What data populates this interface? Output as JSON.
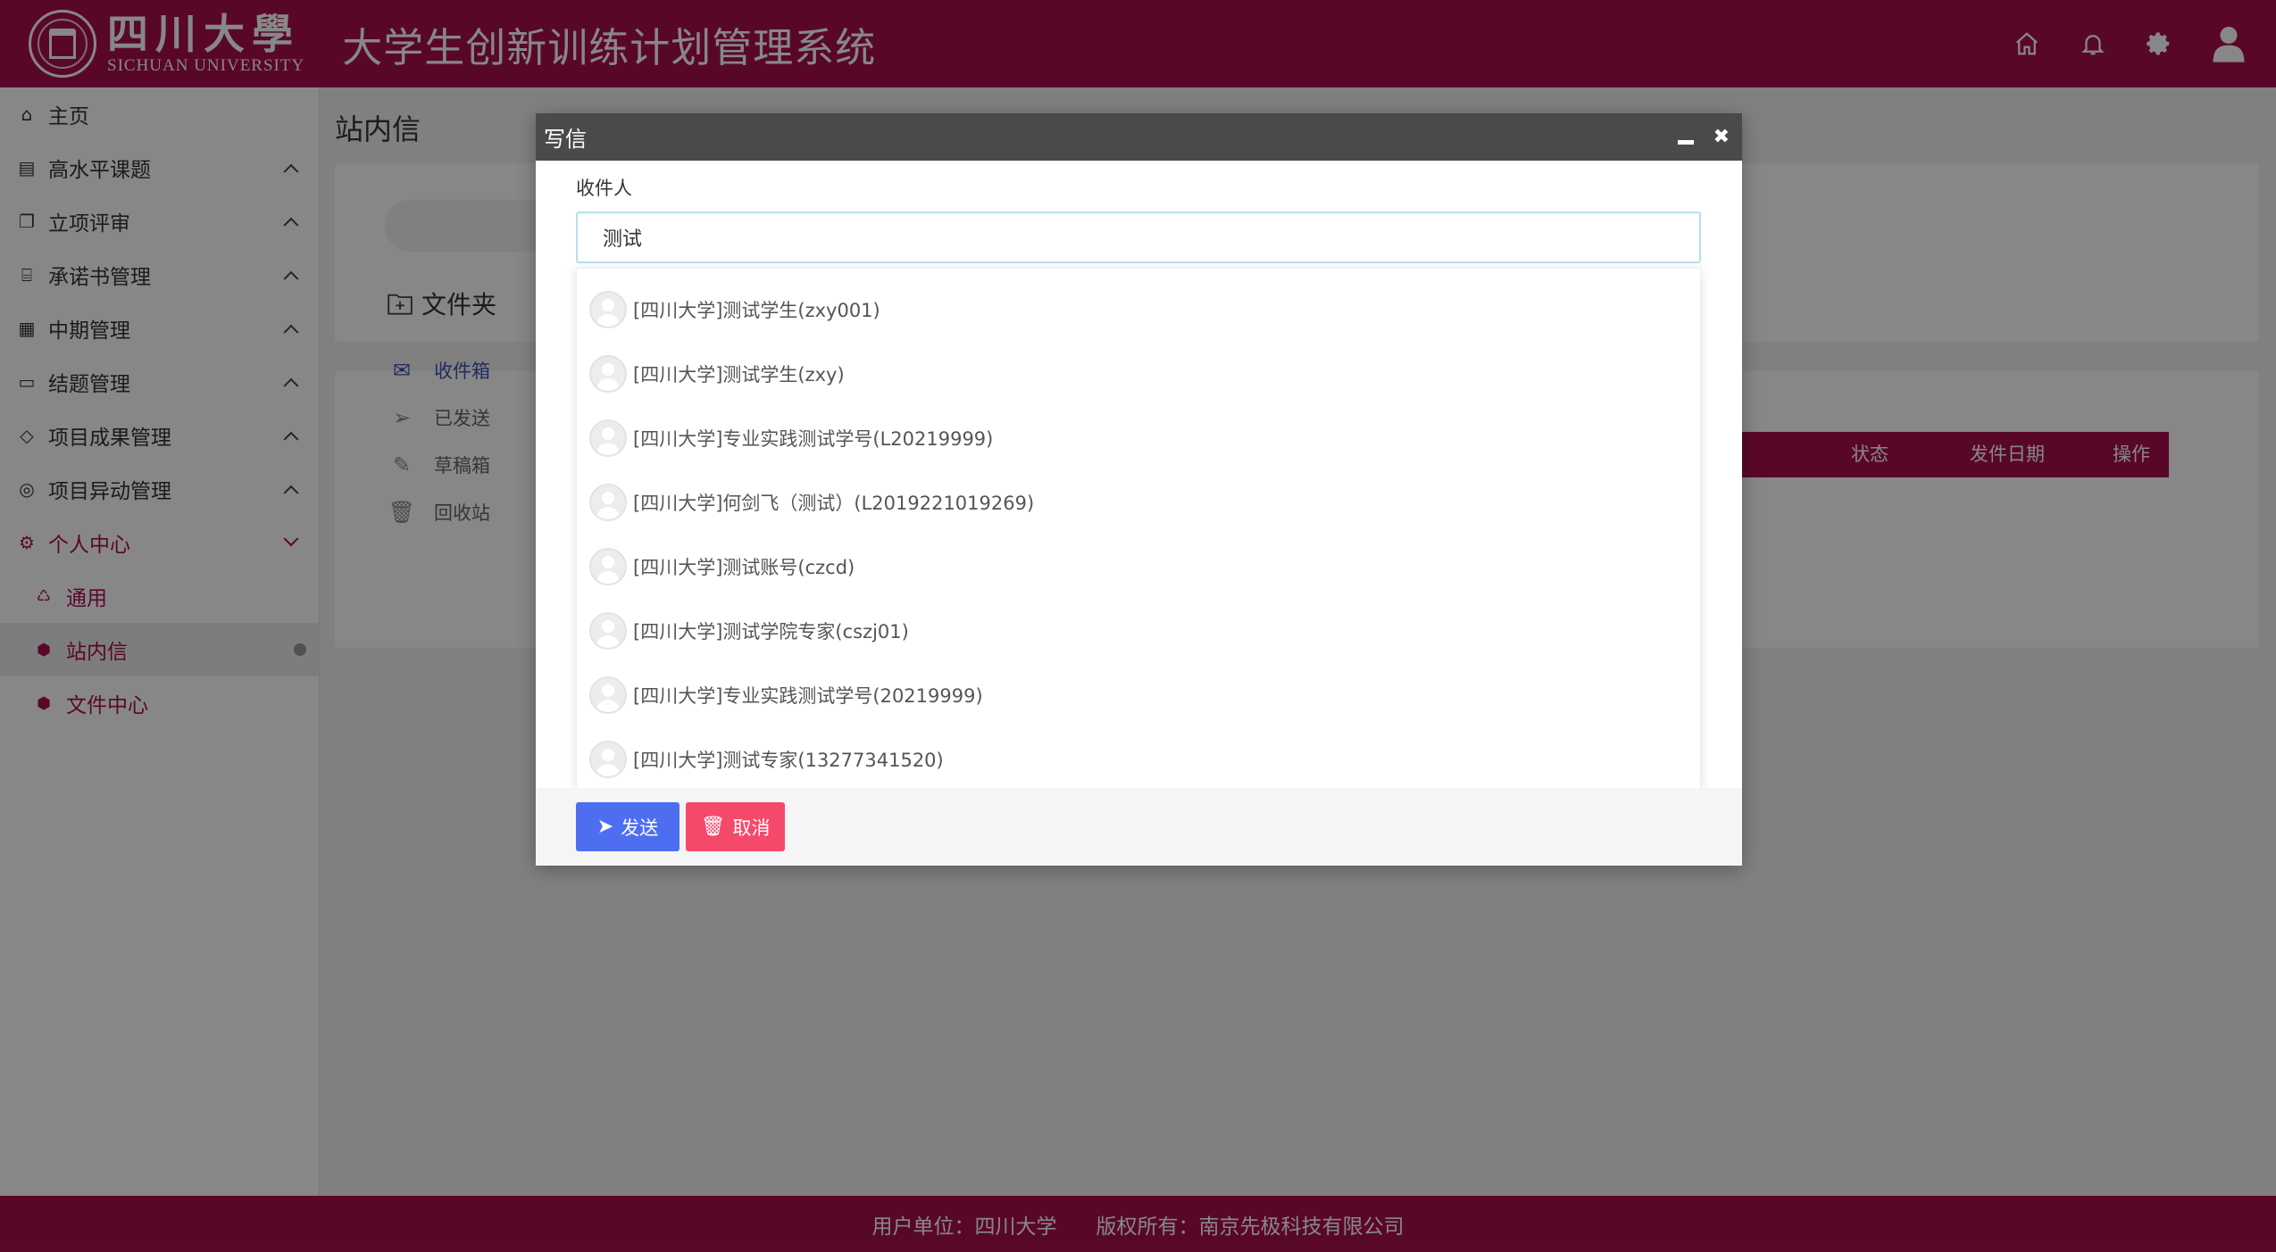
{
  "header": {
    "logo_cn": "四川大學",
    "logo_en": "SICHUAN UNIVERSITY",
    "app_title": "大学生创新训练计划管理系统",
    "icons": [
      "home-icon",
      "bell-icon",
      "gear-icon",
      "user-icon"
    ]
  },
  "sidebar": {
    "items": [
      {
        "label": "主页",
        "icon": "home-icon"
      },
      {
        "label": "高水平课题",
        "icon": "list-icon"
      },
      {
        "label": "立项评审",
        "icon": "copy-icon"
      },
      {
        "label": "承诺书管理",
        "icon": "bank-icon"
      },
      {
        "label": "中期管理",
        "icon": "grid-icon"
      },
      {
        "label": "结题管理",
        "icon": "monitor-icon"
      },
      {
        "label": "项目成果管理",
        "icon": "diamond-icon"
      },
      {
        "label": "项目异动管理",
        "icon": "exchange-icon"
      },
      {
        "label": "个人中心",
        "icon": "settings-icon"
      }
    ],
    "sub_items": [
      {
        "label": "通用",
        "icon": "recycle-icon"
      },
      {
        "label": "站内信",
        "icon": "cube-icon"
      },
      {
        "label": "文件中心",
        "icon": "cube-icon"
      }
    ]
  },
  "main": {
    "page_title": "站内信",
    "folder_title": "文件夹",
    "folders": [
      {
        "label": "收件箱",
        "icon": "envelope-icon"
      },
      {
        "label": "已发送",
        "icon": "paper-plane-icon"
      },
      {
        "label": "草稿箱",
        "icon": "pencil-icon"
      },
      {
        "label": "回收站",
        "icon": "trash-icon"
      }
    ],
    "table_headers": [
      "状态",
      "发件日期",
      "操作"
    ]
  },
  "modal": {
    "title": "写信",
    "recipient_label": "收件人",
    "recipient_value": "测试",
    "suggestions": [
      "[四川大学]测试学生(zxy001)",
      "[四川大学]测试学生(zxy)",
      "[四川大学]专业实践测试学号(L20219999)",
      "[四川大学]何剑飞（测试）(L2019221019269)",
      "[四川大学]测试账号(czcd)",
      "[四川大学]测试学院专家(cszj01)",
      "[四川大学]专业实践测试学号(20219999)",
      "[四川大学]测试专家(13277341520)"
    ],
    "send_label": "发送",
    "cancel_label": "取消"
  },
  "footer": {
    "unit": "用户单位：四川大学",
    "copyright": "版权所有：南京先极科技有限公司"
  },
  "colors": {
    "brand": "#a80f4f",
    "send_button": "#4e6ef2",
    "cancel_button": "#f5496c",
    "modal_title_bar": "#4a4a4a"
  }
}
